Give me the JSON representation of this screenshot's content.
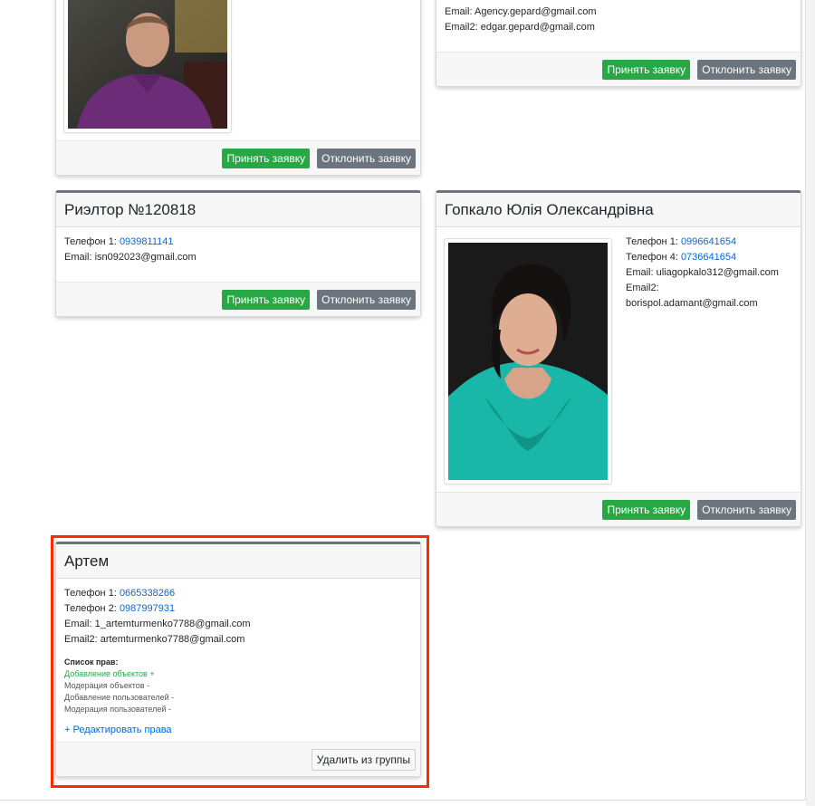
{
  "actions": {
    "accept": "Принять заявку",
    "reject": "Отклонить заявку",
    "remove": "Удалить из группы"
  },
  "card_top_right": {
    "email": "Email: Agency.gepard@gmail.com",
    "email2": "Email2: edgar.gepard@gmail.com"
  },
  "card_realtor": {
    "title": "Риэлтор №120818",
    "phone1_label": "Телефон 1:",
    "phone1": "0939811141",
    "email": "Email: isn092023@gmail.com"
  },
  "card_gopkalo": {
    "title": "Гопкало Юлія Олександрівна",
    "phone1_label": "Телефон 1:",
    "phone1": "0996641654",
    "phone4_label": "Телефон 4:",
    "phone4": "0736641654",
    "email": "Email: uliagopkalo312@gmail.com",
    "email2_label": "Email2:",
    "email2": "borispol.adamant@gmail.com"
  },
  "card_artem": {
    "title": "Артем",
    "phone1_label": "Телефон 1:",
    "phone1": "0665338266",
    "phone2_label": "Телефон 2:",
    "phone2": "0987997931",
    "email": "Email: 1_artemturmenko7788@gmail.com",
    "email2": "Email2: artemturmenko7788@gmail.com",
    "rights_title": "Список прав:",
    "rights": [
      {
        "label": "Добавление объектов +",
        "enabled": true
      },
      {
        "label": "Модерация объектов -",
        "enabled": false
      },
      {
        "label": "Добавление пользователей -",
        "enabled": false
      },
      {
        "label": "Модерация пользователей -",
        "enabled": false
      }
    ],
    "edit_rights": "+ Редактировать права"
  },
  "colors": {
    "accept": "#28a745",
    "reject": "#6c757d",
    "link": "#0069d9",
    "highlight": "#ff2a00"
  }
}
